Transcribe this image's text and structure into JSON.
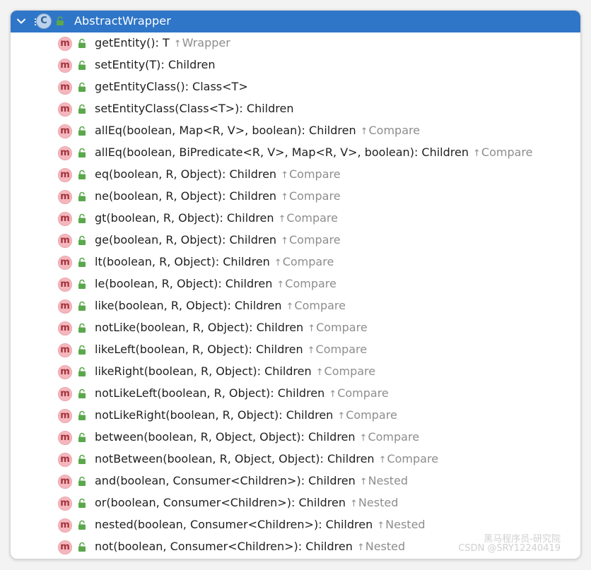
{
  "header": {
    "title": "AbstractWrapper",
    "class_icon_letter": "C",
    "expanded": true
  },
  "method_icon_letter": "m",
  "colors": {
    "header_bg": "#2f76c8",
    "method_icon_bg": "#f5b7bd",
    "lock_green": "#5aa84b",
    "inherited_text": "#8d8d8d"
  },
  "methods": [
    {
      "signature": "getEntity(): T",
      "inherited_from": "Wrapper"
    },
    {
      "signature": "setEntity(T): Children",
      "inherited_from": ""
    },
    {
      "signature": "getEntityClass(): Class<T>",
      "inherited_from": ""
    },
    {
      "signature": "setEntityClass(Class<T>): Children",
      "inherited_from": ""
    },
    {
      "signature": "allEq(boolean, Map<R, V>, boolean): Children",
      "inherited_from": "Compare"
    },
    {
      "signature": "allEq(boolean, BiPredicate<R, V>, Map<R, V>, boolean): Children",
      "inherited_from": "Compare"
    },
    {
      "signature": "eq(boolean, R, Object): Children",
      "inherited_from": "Compare"
    },
    {
      "signature": "ne(boolean, R, Object): Children",
      "inherited_from": "Compare"
    },
    {
      "signature": "gt(boolean, R, Object): Children",
      "inherited_from": "Compare"
    },
    {
      "signature": "ge(boolean, R, Object): Children",
      "inherited_from": "Compare"
    },
    {
      "signature": "lt(boolean, R, Object): Children",
      "inherited_from": "Compare"
    },
    {
      "signature": "le(boolean, R, Object): Children",
      "inherited_from": "Compare"
    },
    {
      "signature": "like(boolean, R, Object): Children",
      "inherited_from": "Compare"
    },
    {
      "signature": "notLike(boolean, R, Object): Children",
      "inherited_from": "Compare"
    },
    {
      "signature": "likeLeft(boolean, R, Object): Children",
      "inherited_from": "Compare"
    },
    {
      "signature": "likeRight(boolean, R, Object): Children",
      "inherited_from": "Compare"
    },
    {
      "signature": "notLikeLeft(boolean, R, Object): Children",
      "inherited_from": "Compare"
    },
    {
      "signature": "notLikeRight(boolean, R, Object): Children",
      "inherited_from": "Compare"
    },
    {
      "signature": "between(boolean, R, Object, Object): Children",
      "inherited_from": "Compare"
    },
    {
      "signature": "notBetween(boolean, R, Object, Object): Children",
      "inherited_from": "Compare"
    },
    {
      "signature": "and(boolean, Consumer<Children>): Children",
      "inherited_from": "Nested"
    },
    {
      "signature": "or(boolean, Consumer<Children>): Children",
      "inherited_from": "Nested"
    },
    {
      "signature": "nested(boolean, Consumer<Children>): Children",
      "inherited_from": "Nested"
    },
    {
      "signature": "not(boolean, Consumer<Children>): Children",
      "inherited_from": "Nested"
    }
  ],
  "watermark": {
    "line1": "黑马程序员-研究院",
    "line2": "CSDN @SRY12240419"
  }
}
